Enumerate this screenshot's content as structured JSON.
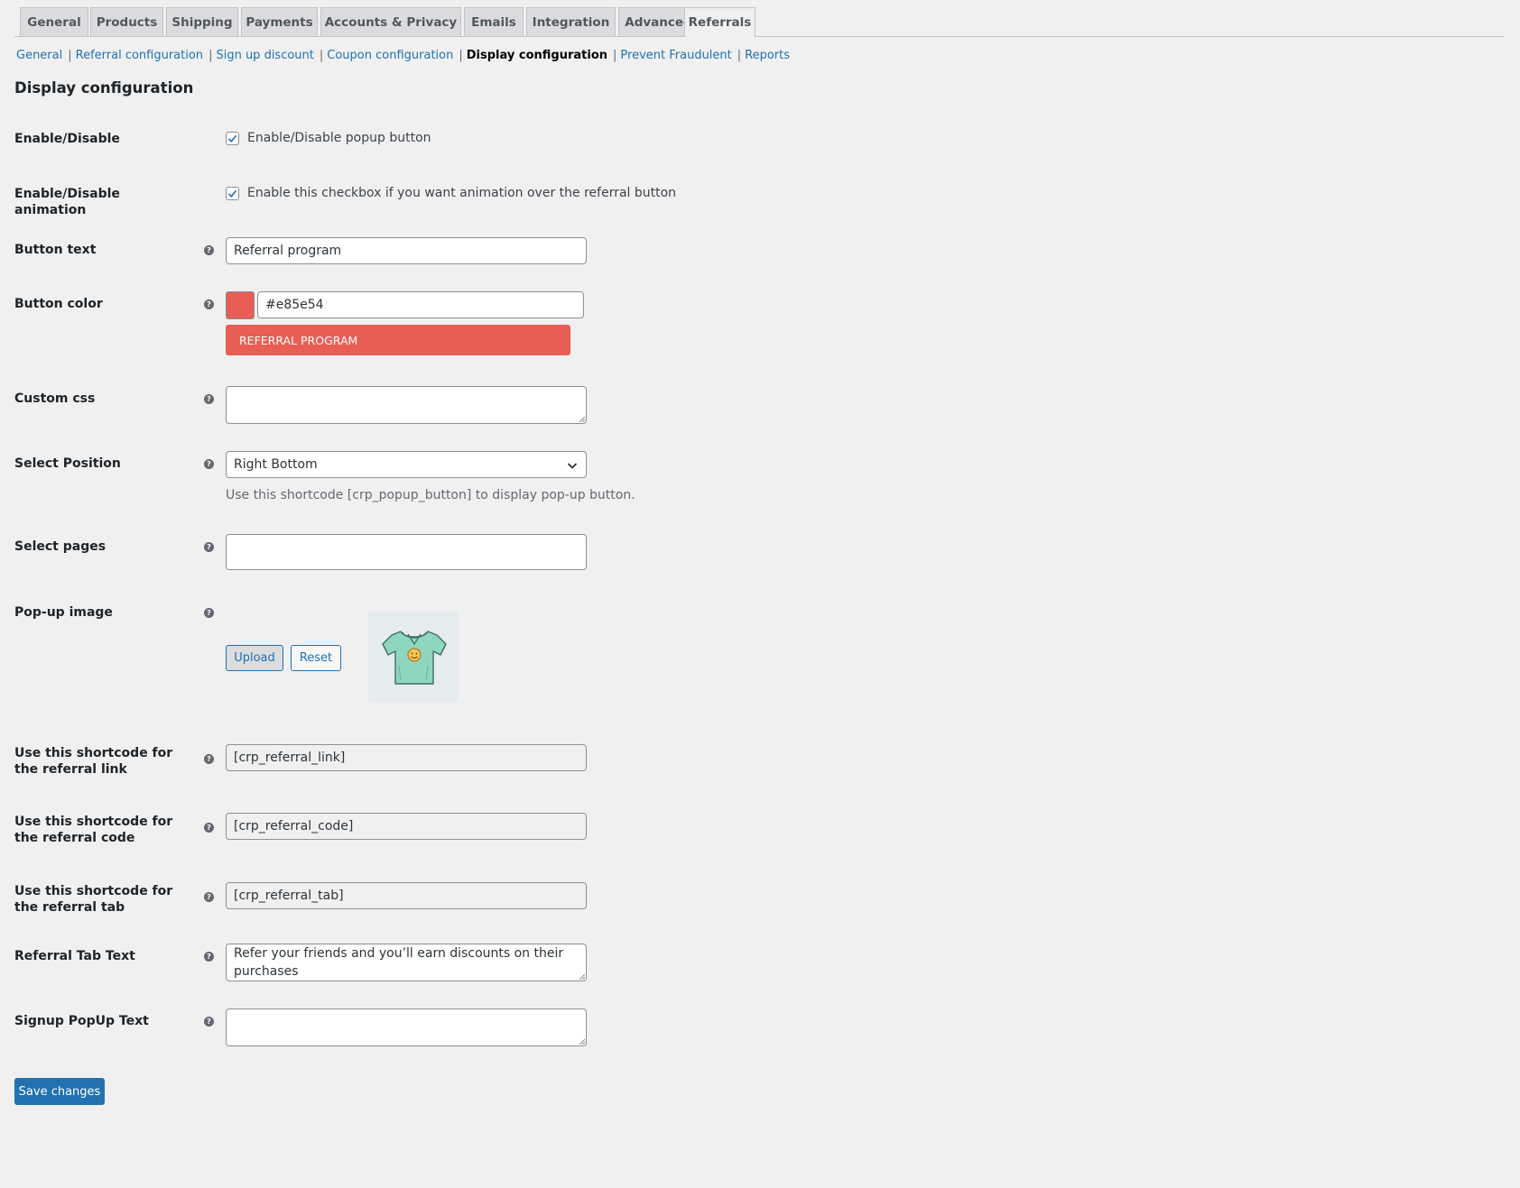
{
  "tabs": [
    {
      "label": "General"
    },
    {
      "label": "Products"
    },
    {
      "label": "Shipping"
    },
    {
      "label": "Payments"
    },
    {
      "label": "Accounts & Privacy"
    },
    {
      "label": "Emails"
    },
    {
      "label": "Integration"
    },
    {
      "label": "Advanced"
    },
    {
      "label": "Referrals",
      "active": true
    }
  ],
  "subnav": [
    {
      "label": "General"
    },
    {
      "label": "Referral configuration"
    },
    {
      "label": "Sign up discount"
    },
    {
      "label": "Coupon configuration"
    },
    {
      "label": "Display configuration",
      "current": true
    },
    {
      "label": "Prevent Fraudulent"
    },
    {
      "label": "Reports"
    }
  ],
  "page": {
    "title": "Display configuration"
  },
  "fields": {
    "enable": {
      "label": "Enable/Disable",
      "checkbox_text": "Enable/Disable popup button",
      "checked": true
    },
    "animation": {
      "label": "Enable/Disable animation",
      "checkbox_text": "Enable this checkbox if you want animation over the referral button",
      "checked": true
    },
    "button_text": {
      "label": "Button text",
      "value": "Referral program"
    },
    "button_color": {
      "label": "Button color",
      "value": "#e85e54",
      "preview_label": "REFERRAL PROGRAM"
    },
    "custom_css": {
      "label": "Custom css",
      "value": ""
    },
    "position": {
      "label": "Select Position",
      "selected": "Right Bottom",
      "description": "Use this shortcode [crp_popup_button] to display pop-up button."
    },
    "pages": {
      "label": "Select pages",
      "value": ""
    },
    "popup_image": {
      "label": "Pop-up image",
      "upload_label": "Upload",
      "reset_label": "Reset"
    },
    "shortcode_link": {
      "label": "Use this shortcode for the referral link",
      "value": "[crp_referral_link]"
    },
    "shortcode_code": {
      "label": "Use this shortcode for the referral code",
      "value": "[crp_referral_code]"
    },
    "shortcode_tab": {
      "label": "Use this shortcode for the referral tab",
      "value": "[crp_referral_tab]"
    },
    "tab_text": {
      "label": "Referral Tab Text",
      "value": "Refer your friends and you’ll earn discounts on their purchases"
    },
    "signup_text": {
      "label": "Signup PopUp Text",
      "value": ""
    }
  },
  "actions": {
    "save_label": "Save changes"
  },
  "colors": {
    "accent": "#2271b1",
    "button_preview": "#e85e54",
    "background": "#f0f0f1"
  },
  "icons": {
    "help": "help-icon",
    "checkbox": "checkmark-icon",
    "select": "chevron-down-icon",
    "popup_image": "tshirt-icon"
  }
}
